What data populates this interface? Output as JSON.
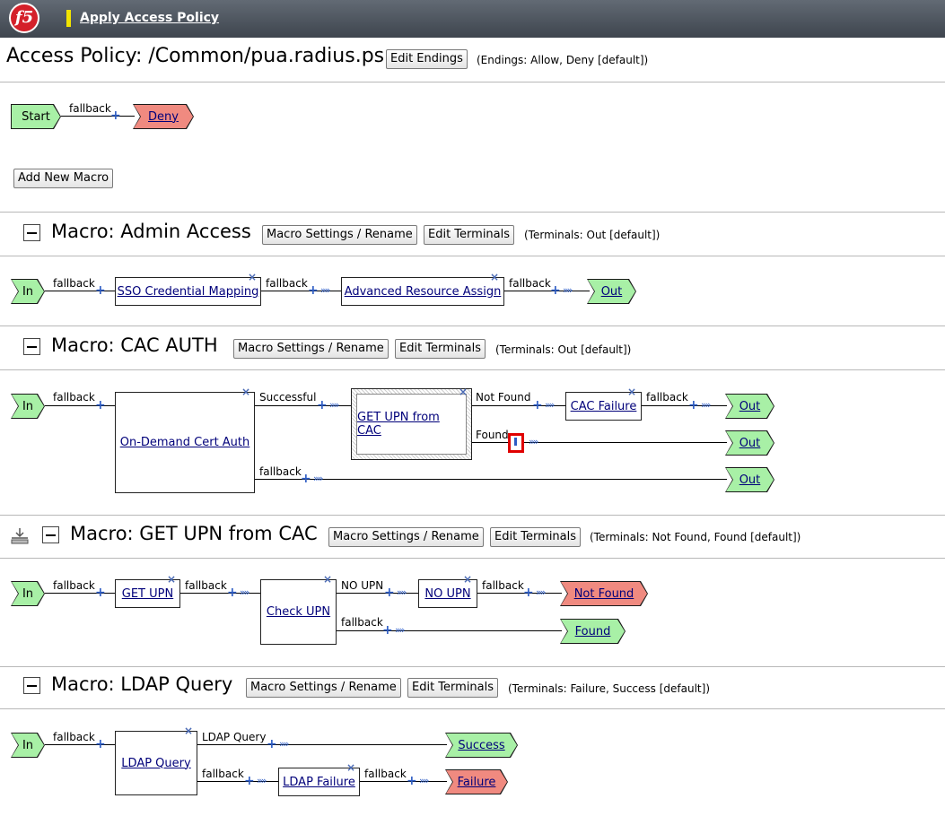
{
  "header": {
    "logo_text": "f5",
    "apply_link": "Apply Access Policy"
  },
  "policy": {
    "title": "Access Policy: /Common/pua.radius.psp",
    "edit_endings_button": "Edit Endings",
    "endings_note": "(Endings: Allow, Deny [default])",
    "start_label": "Start",
    "fallback_label": "fallback",
    "deny_label": "Deny",
    "add_macro_button": "Add New Macro"
  },
  "buttons": {
    "settings": "Macro Settings / Rename",
    "terminals": "Edit Terminals"
  },
  "common": {
    "fallback": "fallback",
    "in": "In",
    "out": "Out"
  },
  "macros": [
    {
      "title": "Macro: Admin Access",
      "terminals_note": "(Terminals: Out [default])",
      "nodes": [
        "SSO Credential Mapping",
        "Advanced Resource Assign"
      ]
    },
    {
      "title": "Macro: CAC AUTH",
      "terminals_note": "(Terminals: Out [default])",
      "nodes": [
        "On-Demand Cert Auth",
        "GET UPN from CAC",
        "CAC Failure"
      ],
      "branches": [
        "Successful",
        "Not Found",
        "Found"
      ]
    },
    {
      "title": "Macro: GET UPN from CAC",
      "terminals_note": "(Terminals: Not Found, Found [default])",
      "nodes": [
        "GET UPN",
        "Check UPN",
        "NO UPN"
      ],
      "branches": [
        "NO UPN"
      ],
      "endings": [
        "Not Found",
        "Found"
      ]
    },
    {
      "title": "Macro: LDAP Query",
      "terminals_note": "(Terminals: Failure, Success [default])",
      "nodes": [
        "LDAP Query",
        "LDAP Failure"
      ],
      "branches": [
        "LDAP Query"
      ],
      "endings": [
        "Success",
        "Failure"
      ]
    }
  ],
  "colors": {
    "terminal_green": "#a8f0a6",
    "terminal_red": "#f08a80",
    "connector_blue": "#2d5cc4",
    "header_bar": "#4f5660"
  },
  "icons": [
    "f5-logo",
    "collapse-icon",
    "delete-x-icon",
    "add-plus-icon",
    "arrow-icon",
    "macro-tree-icon"
  ]
}
